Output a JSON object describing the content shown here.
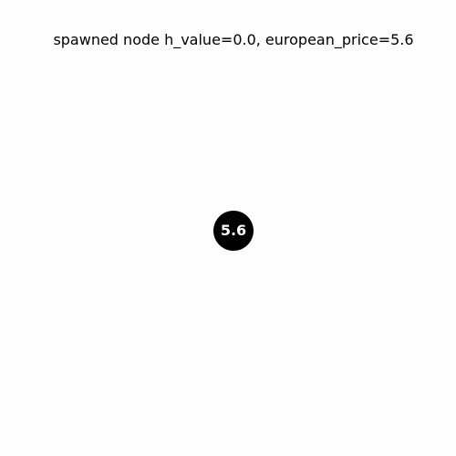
{
  "title": "spawned node h_value=0.0, european_price=5.6",
  "node": {
    "label": "5.6",
    "fill_color": "#000000",
    "text_color": "#ffffff"
  },
  "background_color": "#fdfdfd"
}
